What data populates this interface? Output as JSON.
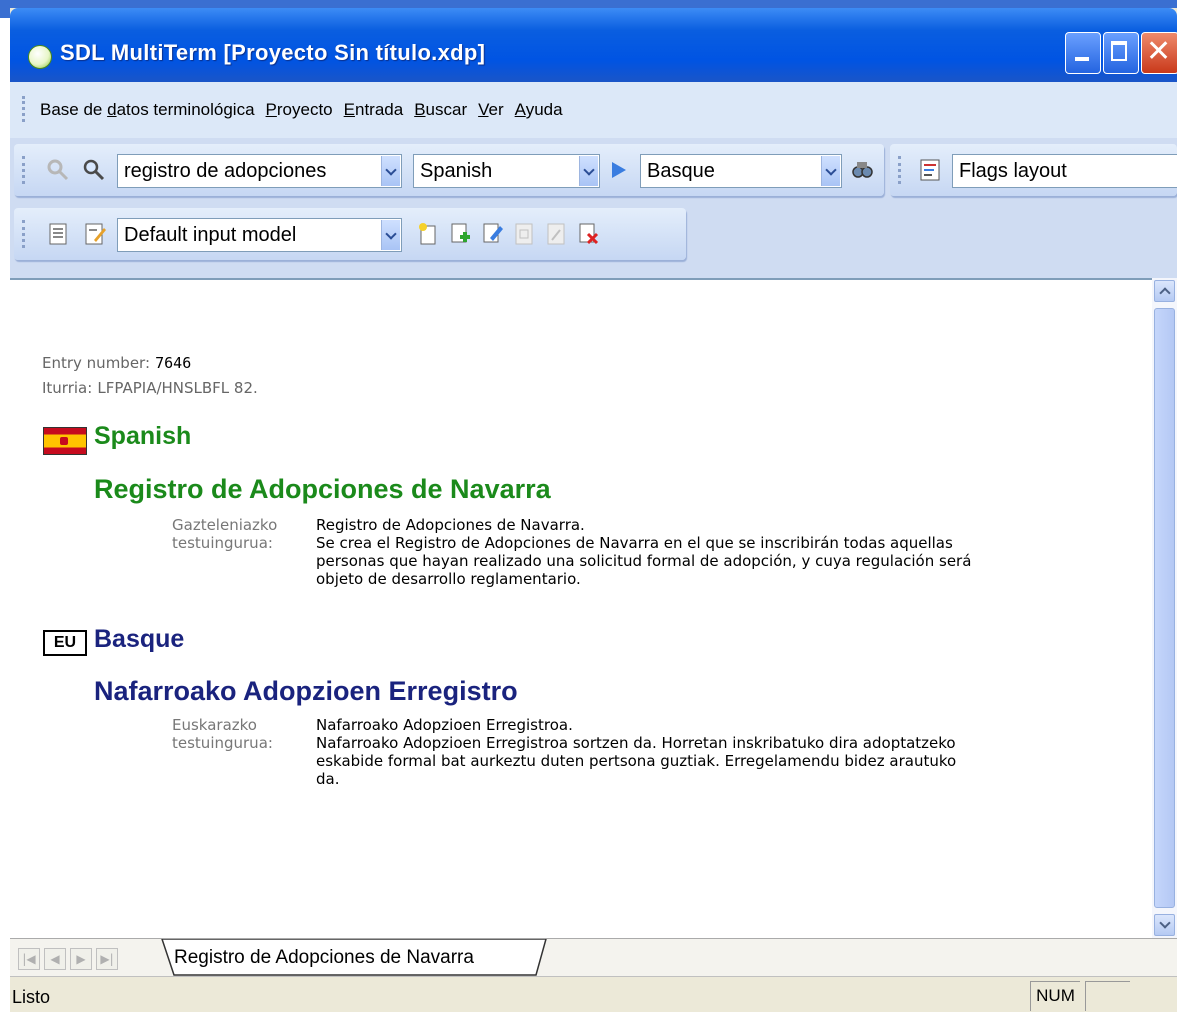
{
  "window": {
    "title": "SDL MultiTerm [Proyecto Sin título.xdp]"
  },
  "menu": [
    "Base de datos terminológica",
    "Proyecto",
    "Entrada",
    "Buscar",
    "Ver",
    "Ayuda"
  ],
  "menu_access_keys": [
    "d",
    "P",
    "E",
    "B",
    "V",
    "A"
  ],
  "toolbar1": {
    "search_value": "registro de adopciones",
    "source_language": "Spanish",
    "target_language": "Basque",
    "layout": "Flags layout"
  },
  "toolbar2": {
    "input_model": "Default input model"
  },
  "entry": {
    "number_label": "Entry number:",
    "number_value": "7646",
    "source_label": "Iturria:",
    "source_value": "LFPAPIA/HNSLBFL 82.",
    "sections": [
      {
        "language": "Spanish",
        "term": "Registro de Adopciones de Navarra",
        "field_label_line1": "Gazteleniazko",
        "field_label_line2": "testuingurua:",
        "context_line1": "Registro de Adopciones de Navarra.",
        "context_lines": [
          "Se crea el Registro de Adopciones de Navarra en el que se inscribirán todas aquellas",
          "personas que hayan realizado una solicitud formal de adopción, y cuya regulación será",
          "objeto de desarrollo reglamentario."
        ]
      },
      {
        "language": "Basque",
        "flag_code": "EU",
        "term": "Nafarroako Adopzioen Erregistro",
        "field_label_line1": "Euskarazko",
        "field_label_line2": "testuingurua:",
        "context_line1": "Nafarroako Adopzioen Erregistroa.",
        "context_lines": [
          "Nafarroako Adopzioen Erregistroa sortzen da. Horretan inskribatuko dira adoptatzeko",
          "eskabide formal bat aurkeztu duten pertsona guztiak. Erregelamendu bidez arautuko",
          "da."
        ]
      }
    ]
  },
  "tabs": {
    "active": "Registro de Adopciones de Navarra"
  },
  "status": {
    "text": "Listo",
    "num": "NUM"
  }
}
